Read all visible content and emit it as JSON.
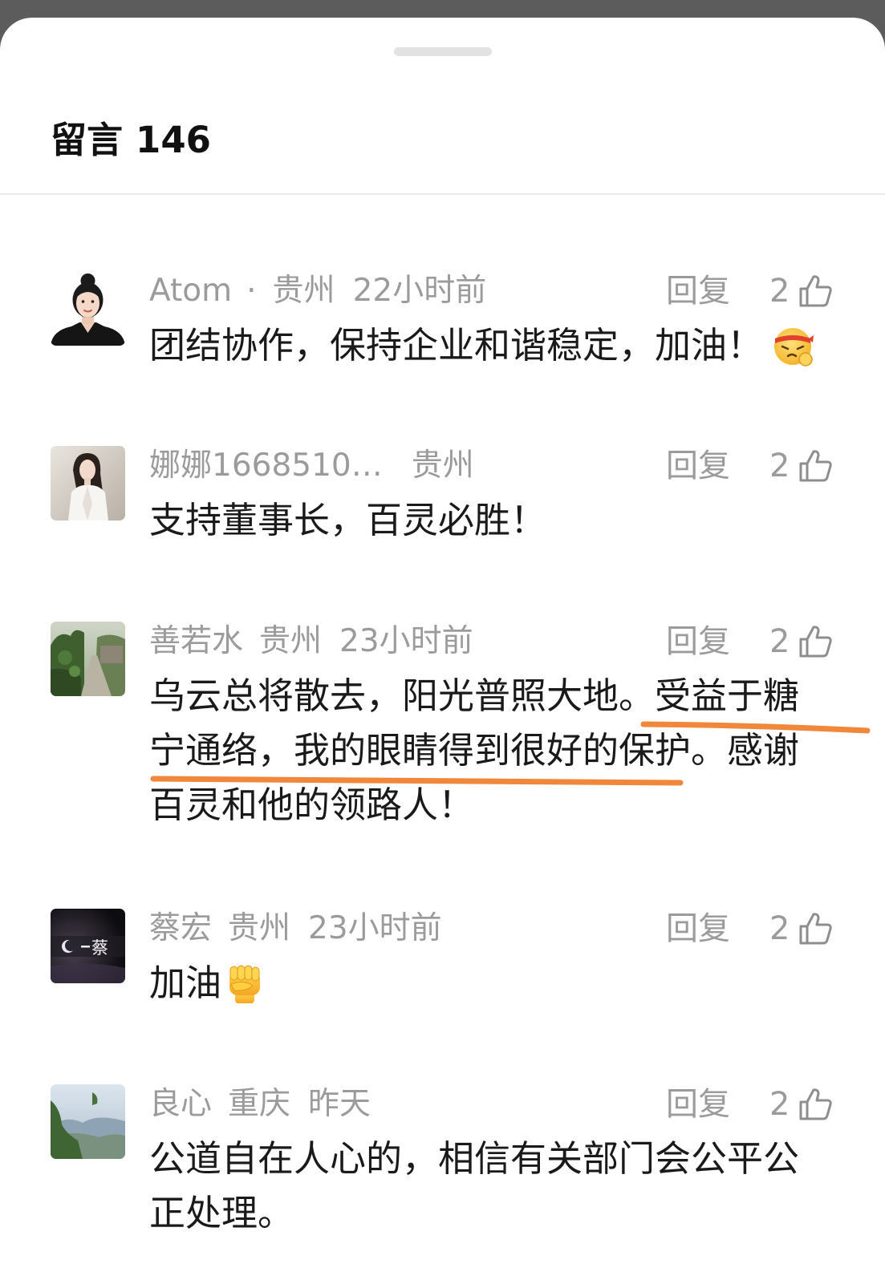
{
  "colors": {
    "backdrop": "#5c5c5c",
    "sheet": "#ffffff",
    "meta_text": "#9b9b9b",
    "body_text": "#1a1a1a",
    "title_text": "#111111",
    "underline": "#f0873a",
    "handle": "#e3e3e3",
    "divider": "#ebebeb",
    "icon": "#8e8e8e"
  },
  "sheet": {
    "title": "留言",
    "count": "146"
  },
  "comments": [
    {
      "name": "Atom",
      "separator": "·",
      "location": "贵州",
      "time": "22小时前",
      "reply_label": "回复",
      "likes": "2",
      "like_icon": "thumbs-up-icon",
      "lines": [
        "团结协作，保持企业和谐稳定，加油！"
      ],
      "emoji": "fighting-face-emoji"
    },
    {
      "name": "娜娜1668510…",
      "location": "贵州",
      "reply_label": "回复",
      "likes": "2",
      "like_icon": "thumbs-up-icon",
      "lines": [
        "支持董事长，百灵必胜！"
      ]
    },
    {
      "name": "善若水",
      "location": "贵州",
      "time": "23小时前",
      "reply_label": "回复",
      "likes": "2",
      "like_icon": "thumbs-up-icon",
      "lines": [
        "乌云总将散去，阳光普照大地。受益于糖",
        "宁通络，我的眼睛得到很好的保护。感谢",
        "百灵和他的领路人！"
      ]
    },
    {
      "name": "蔡宏",
      "location": "贵州",
      "time": "23小时前",
      "avatar_text": "蔡",
      "reply_label": "回复",
      "likes": "2",
      "like_icon": "thumbs-up-icon",
      "lines": [
        "加油"
      ],
      "emoji": "raised-fist-emoji"
    },
    {
      "name": "良心",
      "location": "重庆",
      "time": "昨天",
      "reply_label": "回复",
      "likes": "2",
      "like_icon": "thumbs-up-icon",
      "lines": [
        "公道自在人心的，相信有关部门会公平公",
        "正处理。"
      ]
    }
  ]
}
